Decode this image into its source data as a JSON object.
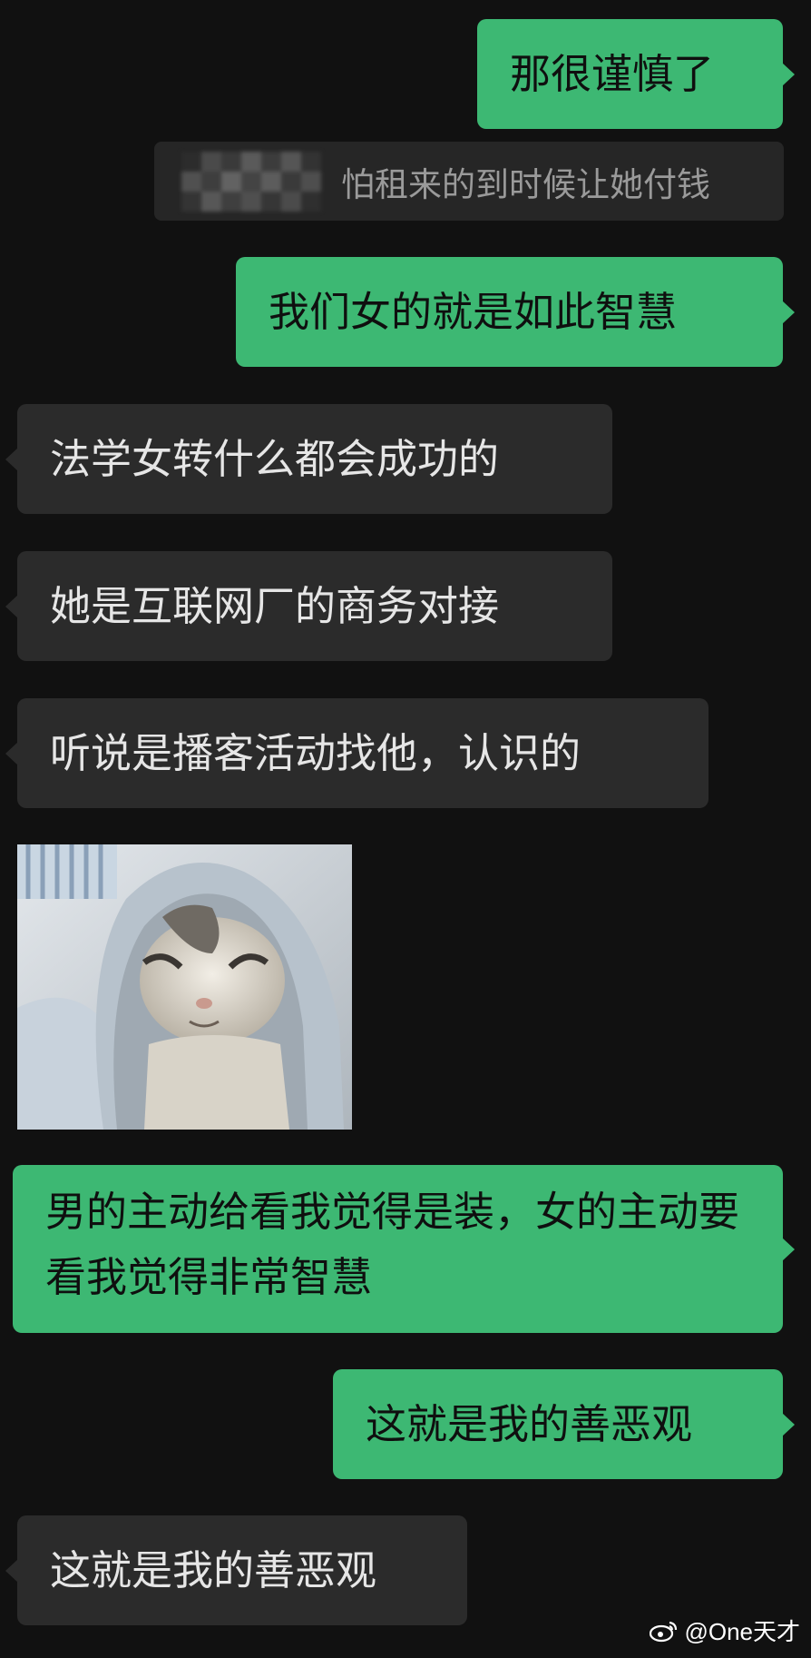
{
  "colors": {
    "background": "#111111",
    "sent_bubble": "#3db873",
    "received_bubble": "#2b2b2b",
    "quote_bubble": "#262626"
  },
  "messages": {
    "m1": "那很谨慎了",
    "quote": "怕租来的到时候让她付钱",
    "m2": "我们女的就是如此智慧",
    "m3": "法学女转什么都会成功的",
    "m4": "她是互联网厂的商务对接",
    "m5": "听说是播客活动找他，认识的",
    "m6": "男的主动给看我觉得是装，女的主动要看我觉得非常智慧",
    "m7": "这就是我的善恶观",
    "m8": "这就是我的善恶观"
  },
  "sticker": {
    "icon": "cat-in-hood-sticker"
  },
  "watermark": {
    "text": "@One天才",
    "icon": "weibo-logo-icon"
  }
}
